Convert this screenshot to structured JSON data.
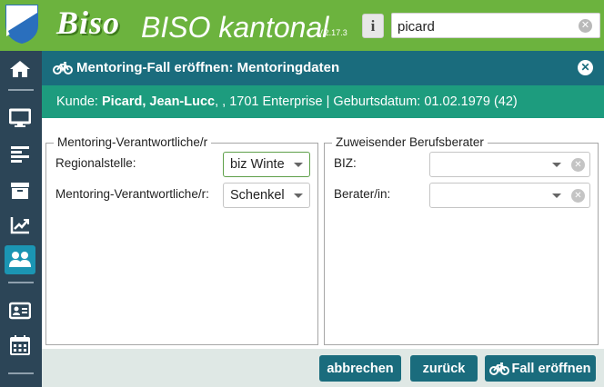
{
  "header": {
    "logo_text": "Biso",
    "app_title": "BISO kantonal",
    "version": "V.2.17.3",
    "info_label": "i",
    "search": {
      "value": "picard",
      "clear_label": "✕"
    }
  },
  "sidebar": {
    "items": [
      {
        "name": "home",
        "icon": "home-icon"
      },
      {
        "name": "desktop",
        "icon": "monitor-icon"
      },
      {
        "name": "list",
        "icon": "text-lines-icon"
      },
      {
        "name": "archive",
        "icon": "archive-icon"
      },
      {
        "name": "statistics",
        "icon": "chart-line-icon"
      },
      {
        "name": "users",
        "icon": "users-icon",
        "active": true
      },
      {
        "name": "contacts",
        "icon": "id-card-icon"
      },
      {
        "name": "calendar",
        "icon": "calendar-icon"
      }
    ]
  },
  "dialog": {
    "title": "Mentoring-Fall eröffnen: Mentoringdaten",
    "close_label": "✕",
    "customer": {
      "prefix": "Kunde: ",
      "name": "Picard, Jean-Lucc",
      "details": ", , 1701 Enterprise | Geburtsdatum: 01.02.1979 (42)"
    },
    "left_group": {
      "legend": "Mentoring-Verantwortliche/r",
      "fields": [
        {
          "label": "Regionalstelle:",
          "value": "biz Winte"
        },
        {
          "label": "Mentoring-Verantwortliche/r:",
          "value": "Schenkel"
        }
      ]
    },
    "right_group": {
      "legend": "Zuweisender Berufsberater",
      "fields": [
        {
          "label": "BIZ:",
          "value": ""
        },
        {
          "label": "Berater/in:",
          "value": ""
        }
      ]
    },
    "buttons": {
      "cancel": "abbrechen",
      "back": "zurück",
      "open": "Fall eröffnen"
    }
  },
  "colors": {
    "header_green": "#6cb33e",
    "sidebar": "#2c4557",
    "dialog_header": "#1a6c7d",
    "customer_bar": "#1d9c7e",
    "active_item": "#1b95b3"
  }
}
